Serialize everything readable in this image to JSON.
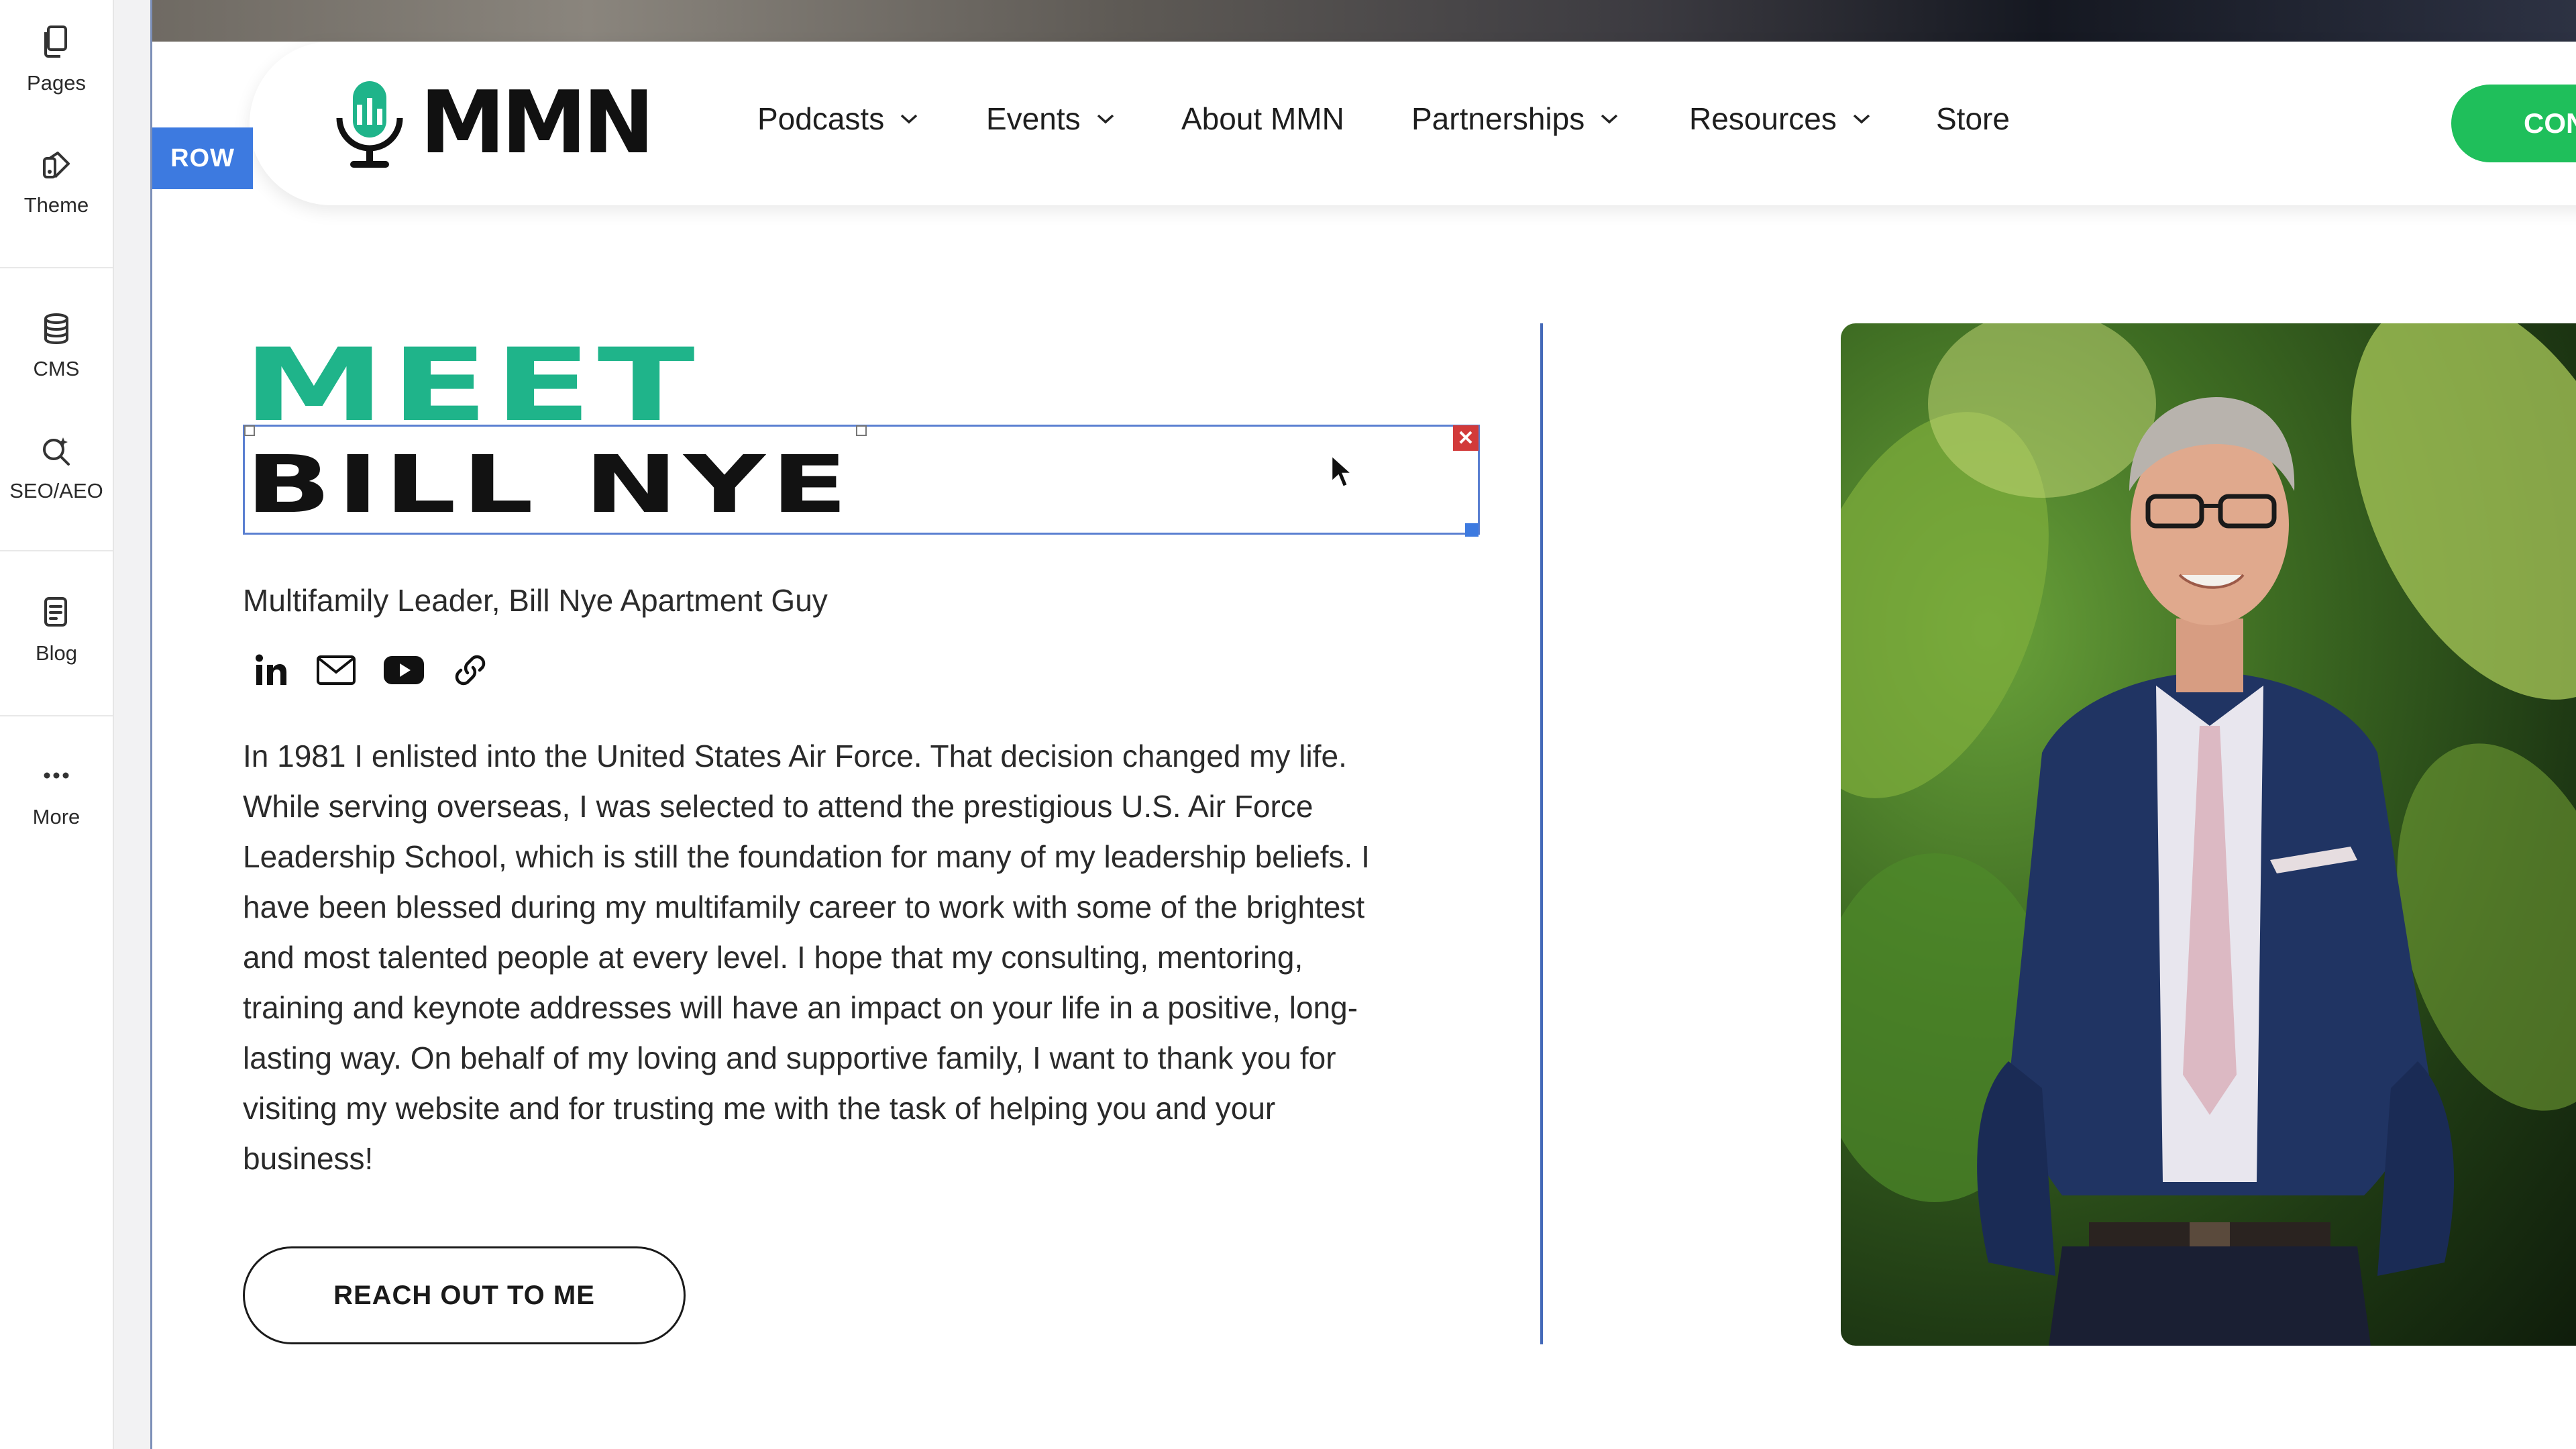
{
  "sidebar": {
    "items": [
      {
        "label": "Pages",
        "icon": "pages-icon"
      },
      {
        "label": "Theme",
        "icon": "theme-icon"
      },
      {
        "label": "CMS",
        "icon": "cms-icon"
      },
      {
        "label": "SEO/AEO",
        "icon": "seo-icon"
      },
      {
        "label": "Blog",
        "icon": "blog-icon"
      },
      {
        "label": "More",
        "icon": "more-icon"
      }
    ]
  },
  "editor": {
    "row_tag": "ROW",
    "selection_color": "#5a7fd1",
    "close_color": "#d23a3a"
  },
  "header": {
    "logo_text": "MMN",
    "nav": [
      {
        "label": "Podcasts",
        "dropdown": true
      },
      {
        "label": "Events",
        "dropdown": true
      },
      {
        "label": "About MMN",
        "dropdown": false
      },
      {
        "label": "Partnerships",
        "dropdown": true
      },
      {
        "label": "Resources",
        "dropdown": true
      },
      {
        "label": "Store",
        "dropdown": false
      }
    ],
    "cta_label": "CON",
    "cta_color": "#1fbf5b"
  },
  "hero": {
    "eyebrow": "MEET",
    "eyebrow_color": "#1fb48a",
    "name": "BILL NYE",
    "subtitle": "Multifamily Leader, Bill Nye Apartment Guy",
    "socials": [
      "linkedin-icon",
      "email-icon",
      "youtube-icon",
      "link-icon"
    ],
    "bio": "In 1981 I enlisted into the United States Air Force. That decision changed my life. While serving overseas, I was selected to attend the prestigious U.S. Air Force Leadership School, which is still the foundation for many of my leadership beliefs. I have been blessed during my multifamily career to work with some of the brightest and most talented people at every level. I hope that my consulting, mentoring, training and keynote addresses will have an impact on your life in a positive, long-lasting way. On behalf of my loving and supportive family, I want to thank you for visiting my website and for trusting me with the task of helping you and your business!",
    "button_label": "REACH OUT TO ME"
  }
}
